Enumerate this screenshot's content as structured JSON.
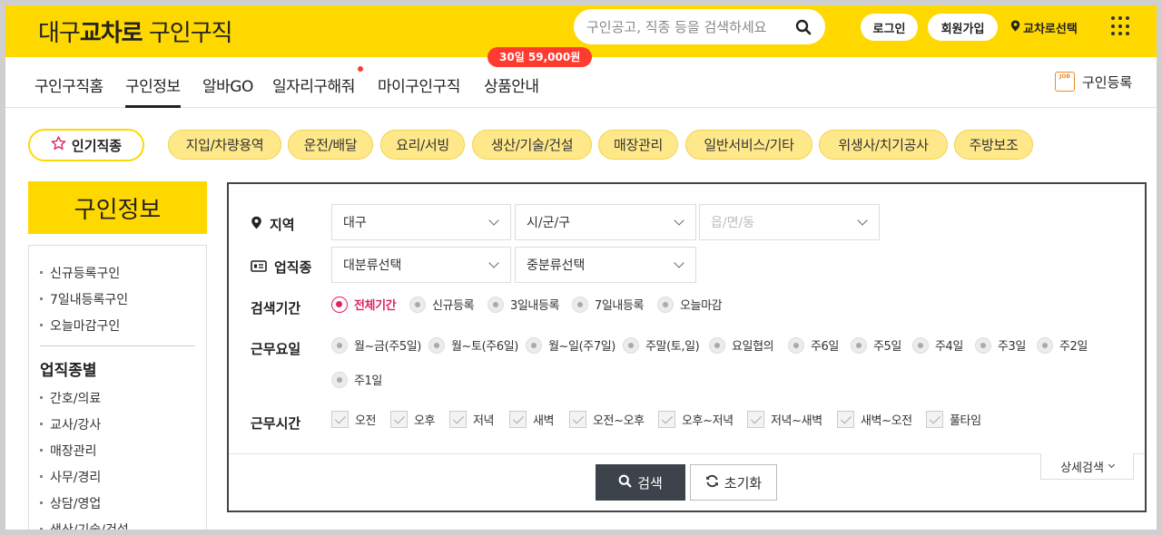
{
  "header": {
    "logo_prefix": "대구",
    "logo_brand": "교차로",
    "logo_suffix": "구인구직",
    "search_placeholder": "구인공고, 직종 등을 검색하세요",
    "login": "로그인",
    "signup": "회원가입",
    "region_select": "교차로선택"
  },
  "nav": {
    "items": [
      "구인구직홈",
      "구인정보",
      "알바GO",
      "일자리구해줘",
      "마이구인구직",
      "상품안내"
    ],
    "active_index": 1,
    "promo": "30일 59,000원",
    "register": "구인등록",
    "job_icon_text": "JOB"
  },
  "chips": {
    "popular_label": "인기직종",
    "items": [
      "지입/차량용역",
      "운전/배달",
      "요리/서빙",
      "생산/기술/건설",
      "매장관리",
      "일반서비스/기타",
      "위생사/치기공사",
      "주방보조"
    ]
  },
  "sidebar": {
    "title": "구인정보",
    "links": [
      "신규등록구인",
      "7일내등록구인",
      "오늘마감구인"
    ],
    "section": "업직종별",
    "categories": [
      "간호/의료",
      "교사/강사",
      "매장관리",
      "사무/경리",
      "상담/영업",
      "생산/기술/건설"
    ]
  },
  "filters": {
    "region": {
      "label": "지역",
      "selects": [
        "대구",
        "시/군/구",
        "읍/면/동"
      ]
    },
    "job_type": {
      "label": "업직종",
      "selects": [
        "대분류선택",
        "중분류선택"
      ]
    },
    "period": {
      "label": "검색기간",
      "options": [
        "전체기간",
        "신규등록",
        "3일내등록",
        "7일내등록",
        "오늘마감"
      ],
      "selected_index": 0
    },
    "workdays": {
      "label": "근무요일",
      "options": [
        "월~금(주5일)",
        "월~토(주6일)",
        "월~일(주7일)",
        "주말(토,일)",
        "요일협의",
        "주6일",
        "주5일",
        "주4일",
        "주3일",
        "주2일",
        "주1일"
      ]
    },
    "worktime": {
      "label": "근무시간",
      "options": [
        "오전",
        "오후",
        "저녁",
        "새벽",
        "오전~오후",
        "오후~저녁",
        "저녁~새벽",
        "새벽~오전",
        "풀타임"
      ]
    },
    "search_button": "검색",
    "reset_button": "초기화",
    "detail_button": "상세검색"
  }
}
